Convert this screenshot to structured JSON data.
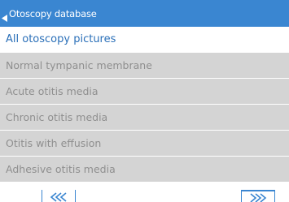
{
  "header": {
    "title": "Otoscopy database",
    "back_icon": "triangle-left-icon"
  },
  "list": {
    "items": [
      {
        "label": "All otoscopy pictures",
        "selected": true
      },
      {
        "label": "Normal tympanic membrane",
        "selected": false
      },
      {
        "label": "Acute otitis media",
        "selected": false
      },
      {
        "label": "Chronic otitis media",
        "selected": false
      },
      {
        "label": "Otitis with effusion",
        "selected": false
      },
      {
        "label": "Adhesive otitis media",
        "selected": false
      }
    ]
  },
  "pagination": {
    "prev_icon": "double-chevron-left-icon",
    "next_icon": "double-chevron-right-icon"
  },
  "colors": {
    "accent": "#3a86d1",
    "selected_text": "#2a6fb8",
    "row_background": "#d4d4d4",
    "row_text": "#8f8f8f"
  }
}
